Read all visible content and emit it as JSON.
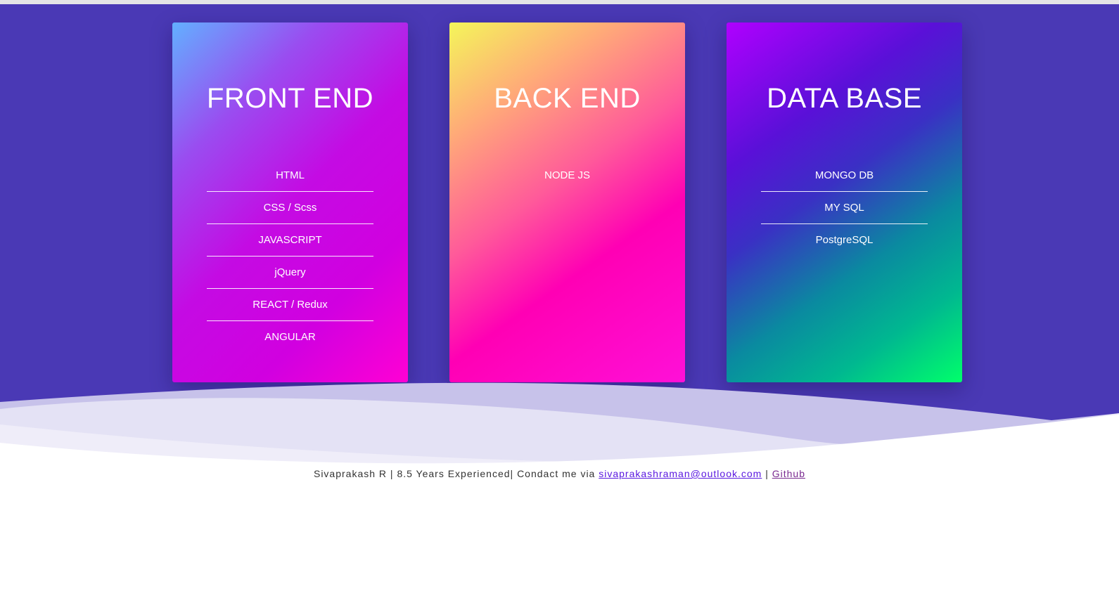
{
  "cards": [
    {
      "title": "FRONT END",
      "skills": [
        "HTML",
        "CSS / Scss",
        "JAVASCRIPT",
        "jQuery",
        "REACT / Redux",
        "ANGULAR"
      ]
    },
    {
      "title": "BACK END",
      "skills": [
        "NODE JS"
      ]
    },
    {
      "title": "DATA BASE",
      "skills": [
        "MONGO DB",
        "MY SQL",
        "PostgreSQL"
      ]
    }
  ],
  "footer": {
    "text": "Sivaprakash R | 8.5 Years Experienced| Condact me via ",
    "email": "sivaprakashraman@outlook.com",
    "separator": " | ",
    "github": "Github"
  },
  "colors": {
    "hero_background": "#4a39b5",
    "link": "#5a18e0"
  }
}
